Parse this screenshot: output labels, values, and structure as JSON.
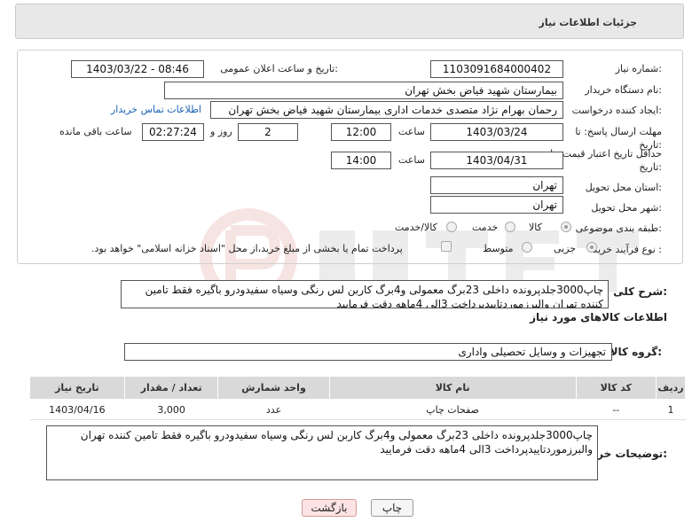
{
  "header": {
    "title": "جزئیات اطلاعات نیاز"
  },
  "need_number": {
    "label": "شماره نیاز:",
    "value": "1103091684000402"
  },
  "announce": {
    "label": "تاریخ و ساعت اعلان عمومی:",
    "value": "1403/03/22 - 08:46"
  },
  "buyer_org": {
    "label": "نام دستگاه خریدار:",
    "value": "بیمارستان شهید فیاض بخش تهران"
  },
  "requester": {
    "label": "ایجاد کننده درخواست:",
    "value": "رحمان بهرام نژاد متصدی خدمات اداری بیمارستان شهید فیاض بخش تهران",
    "contact_link": "اطلاعات تماس خریدار"
  },
  "deadline": {
    "label": "مهلت ارسال پاسخ: تا تاریخ:",
    "date": "1403/03/24",
    "time_label": "ساعت",
    "time": "12:00",
    "days": "2",
    "days_label": "روز و",
    "remaining": "02:27:24",
    "remaining_label": "ساعت باقی مانده"
  },
  "validity": {
    "label": "حداقل تاریخ اعتبار قیمت: تا تاریخ:",
    "date": "1403/04/31",
    "time_label": "ساعت",
    "time": "14:00"
  },
  "province": {
    "label": "استان محل تحویل:",
    "value": "تهران"
  },
  "city": {
    "label": "شهر محل تحویل:",
    "value": "تهران"
  },
  "category": {
    "label": "طبقه بندی موضوعی:",
    "options": [
      "کالا",
      "خدمت",
      "کالا/خدمت"
    ],
    "selected": "کالا"
  },
  "process": {
    "label": "نوع فرآیند خرید :",
    "options": [
      "جزیی",
      "متوسط"
    ],
    "selected": "جزیی",
    "payment_note": "پرداخت تمام یا بخشی از مبلغ خرید،از محل \"اسناد خزانه اسلامی\" خواهد بود."
  },
  "description": {
    "label": "شرح کلی نیاز:",
    "text": "چاپ3000جلدپرونده داخلی 23برگ معمولی و4برگ کاربن لس رنگی وسیاه سفیدودرو باگیره فقط تامین کننده تهران والبرزموردتاییدپرداخت 3الی 4ماهه دقت فرمایید"
  },
  "goods_section": {
    "title": "اطلاعات کالاهای مورد نیاز"
  },
  "goods_group": {
    "label": "گروه کالا:",
    "value": "تجهیزات و وسایل تحصیلی واداری"
  },
  "table": {
    "headers": [
      "ردیف",
      "کد کالا",
      "نام کالا",
      "واحد شمارش",
      "تعداد / مقدار",
      "تاریخ نیاز"
    ],
    "rows": [
      [
        "1",
        "--",
        "صفحات چاپ",
        "عدد",
        "3,000",
        "1403/04/16"
      ]
    ]
  },
  "buyer_notes": {
    "label": "توضیحات خریدار:",
    "text": "چاپ3000جلدپرونده داخلی 23برگ معمولی و4برگ کاربن لس رنگی وسیاه سفیدودرو باگیره فقط تامین کننده تهران والبرزموردتاییدپرداخت 3الی 4ماهه دقت فرمایید"
  },
  "buttons": {
    "print": "چاپ",
    "back": "بازگشت"
  },
  "colors": {
    "link": "#1a62b5",
    "back_button_bg": "#fde3e3",
    "print_button_bg": "#f5f5f5"
  }
}
